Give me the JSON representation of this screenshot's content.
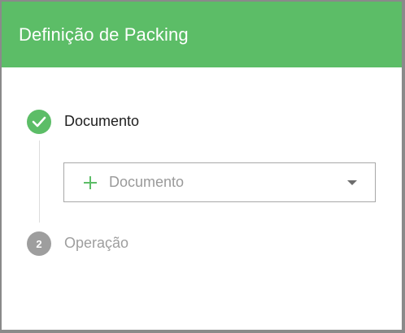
{
  "dialog": {
    "title": "Definição de Packing"
  },
  "steps": [
    {
      "label": "Documento",
      "state": "completed",
      "icon": "check-icon"
    },
    {
      "number": "2",
      "label": "Operação",
      "state": "inactive"
    }
  ],
  "document_select": {
    "placeholder": "Documento",
    "icon": "plus-icon",
    "dropdown_icon": "caret-down-icon"
  },
  "colors": {
    "accent": "#5cbd67",
    "inactive": "#9e9e9e",
    "border": "#a8a8a8"
  }
}
